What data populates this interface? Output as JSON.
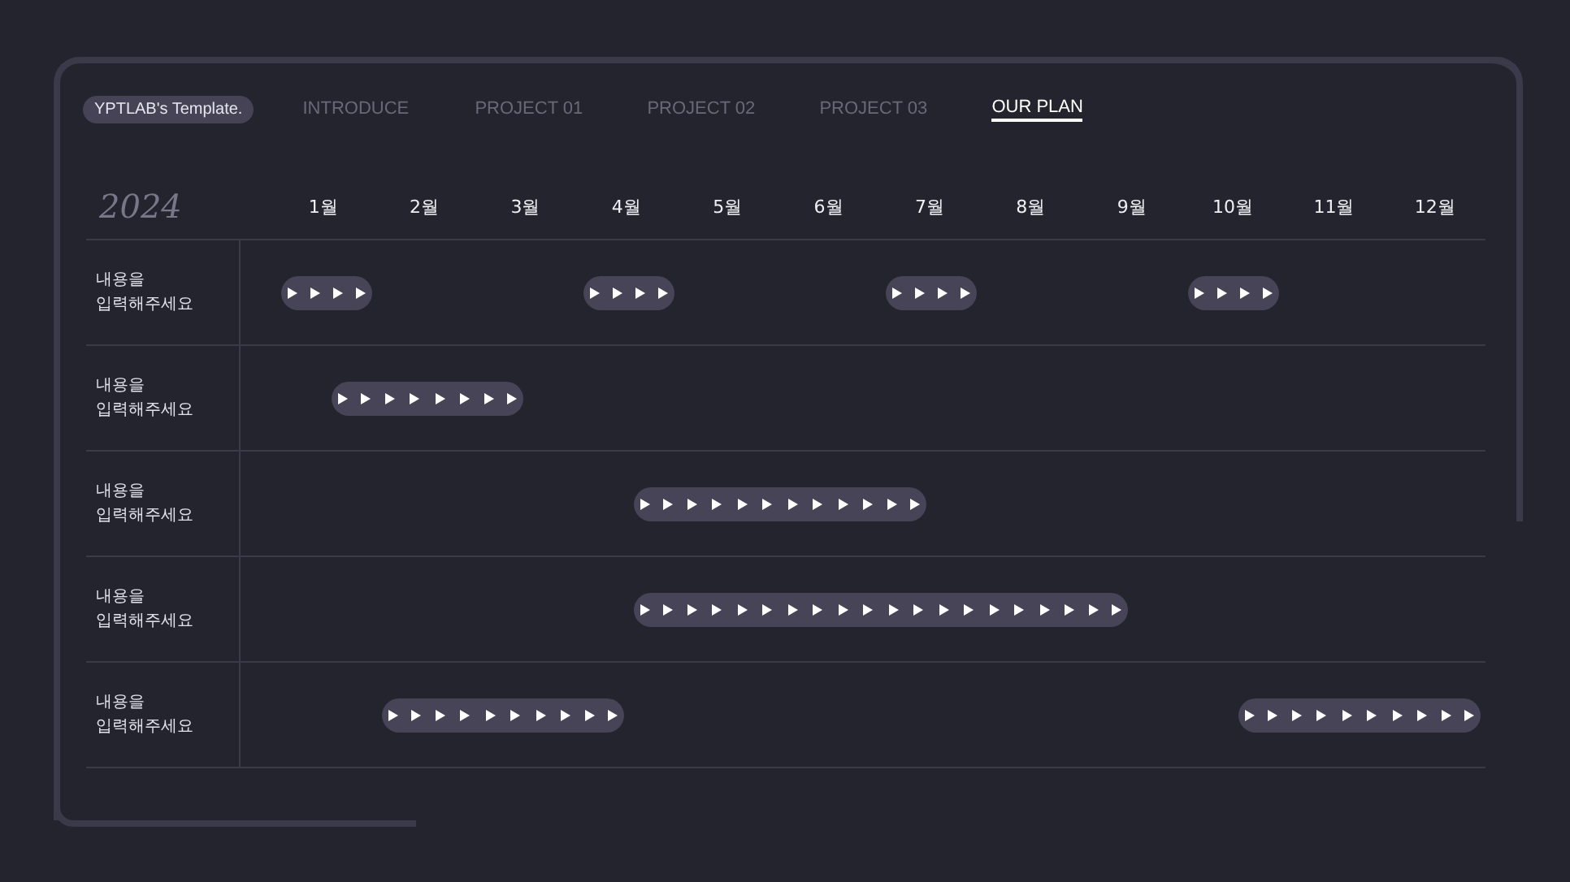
{
  "nav": {
    "brand": "YPTLAB's Template.",
    "tabs": [
      {
        "label": "INTRODUCE",
        "selected": false
      },
      {
        "label": "PROJECT 01",
        "selected": false
      },
      {
        "label": "PROJECT 02",
        "selected": false
      },
      {
        "label": "PROJECT 03",
        "selected": false
      },
      {
        "label": "OUR PLAN",
        "selected": true
      }
    ]
  },
  "timeline": {
    "year": "2024",
    "months": [
      "1월",
      "2월",
      "3월",
      "4월",
      "5월",
      "6월",
      "7월",
      "8월",
      "9월",
      "10월",
      "11월",
      "12월"
    ],
    "rows": [
      {
        "label": "내용을\n입력해주세요",
        "half_months": [
          true,
          true,
          false,
          false,
          false,
          false,
          true,
          true,
          false,
          false,
          false,
          false,
          true,
          true,
          false,
          false,
          false,
          false,
          true,
          true,
          false,
          false,
          false,
          false
        ]
      },
      {
        "label": "내용을\n입력해주세요",
        "half_months": [
          false,
          true,
          true,
          true,
          true,
          false,
          false,
          false,
          false,
          false,
          false,
          false,
          false,
          false,
          false,
          false,
          false,
          false,
          false,
          false,
          false,
          false,
          false,
          false
        ]
      },
      {
        "label": "내용을\n입력해주세요",
        "half_months": [
          false,
          false,
          false,
          false,
          false,
          false,
          false,
          true,
          true,
          true,
          true,
          true,
          true,
          false,
          false,
          false,
          false,
          false,
          false,
          false,
          false,
          false,
          false,
          false
        ]
      },
      {
        "label": "내용을\n입력해주세요",
        "half_months": [
          false,
          false,
          false,
          false,
          false,
          false,
          false,
          true,
          true,
          true,
          true,
          true,
          true,
          true,
          true,
          true,
          true,
          false,
          false,
          false,
          false,
          false,
          false,
          false
        ]
      },
      {
        "label": "내용을\n입력해주세요",
        "half_months": [
          false,
          false,
          true,
          true,
          true,
          true,
          true,
          false,
          false,
          false,
          false,
          false,
          false,
          false,
          false,
          false,
          false,
          false,
          false,
          true,
          true,
          true,
          true,
          true
        ]
      }
    ]
  }
}
